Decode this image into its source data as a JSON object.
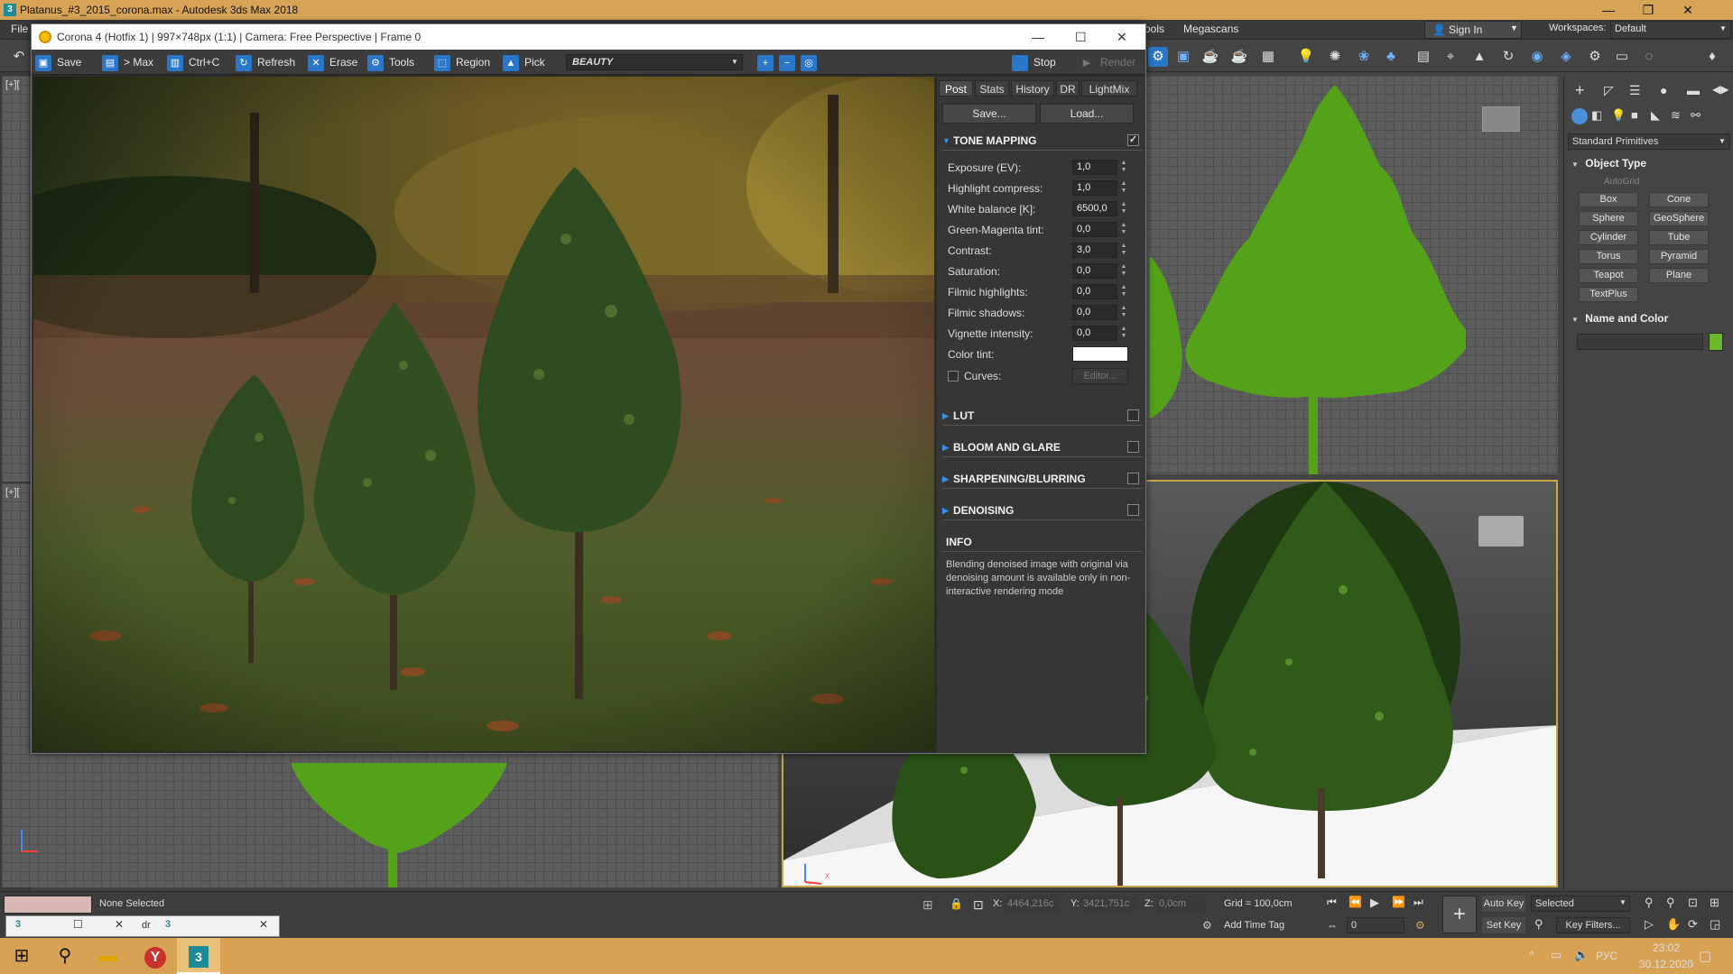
{
  "window": {
    "title": "Platanus_#3_2015_corona.max - Autodesk 3ds Max 2018",
    "app_icon": "3"
  },
  "menubar": {
    "file": "File",
    "tools_partial": "ools",
    "megascans": "Megascans",
    "sign_in": "Sign In",
    "workspaces_label": "Workspaces:",
    "workspaces_value": "Default"
  },
  "vfb": {
    "title": "Corona 4 (Hotfix 1) | 997×748px (1:1) | Camera: Free Perspective | Frame 0",
    "toolbar": {
      "save": "Save",
      "to_max": "> Max",
      "copy": "Ctrl+C",
      "refresh": "Refresh",
      "erase": "Erase",
      "tools": "Tools",
      "region": "Region",
      "pick": "Pick",
      "channel": "BEAUTY",
      "stop": "Stop",
      "render": "Render"
    },
    "tabs": [
      "Post",
      "Stats",
      "History",
      "DR",
      "LightMix"
    ],
    "save_btn": "Save...",
    "load_btn": "Load...",
    "tone_mapping": {
      "header": "TONE MAPPING",
      "enabled": "✓",
      "rows": [
        {
          "label": "Exposure (EV):",
          "value": "1,0"
        },
        {
          "label": "Highlight compress:",
          "value": "1,0"
        },
        {
          "label": "White balance [K]:",
          "value": "6500,0"
        },
        {
          "label": "Green-Magenta tint:",
          "value": "0,0"
        },
        {
          "label": "Contrast:",
          "value": "3,0"
        },
        {
          "label": "Saturation:",
          "value": "0,0"
        },
        {
          "label": "Filmic highlights:",
          "value": "0,0"
        },
        {
          "label": "Filmic shadows:",
          "value": "0,0"
        },
        {
          "label": "Vignette intensity:",
          "value": "0,0"
        }
      ],
      "color_tint": "Color tint:",
      "color_tint_value": "#ffffff",
      "curves": "Curves:",
      "editor": "Editor..."
    },
    "sections": [
      "LUT",
      "BLOOM AND GLARE",
      "SHARPENING/BLURRING",
      "DENOISING"
    ],
    "info_header": "INFO",
    "info_text": "Blending denoised image with original via denoising amount is available only in non-interactive rendering mode"
  },
  "viewports": {
    "top_left_label": "[+][",
    "left_mid_label": "[+][",
    "persp_axis": "x"
  },
  "command_panel": {
    "dropdown": "Standard Primitives",
    "object_type": "Object Type",
    "autogrid": "AutoGrid",
    "buttons": [
      "Box",
      "Cone",
      "Sphere",
      "GeoSphere",
      "Cylinder",
      "Tube",
      "Torus",
      "Pyramid",
      "Teapot",
      "Plane",
      "TextPlus"
    ],
    "name_and_color": "Name and Color",
    "swatch": "#6ab82c"
  },
  "status": {
    "selection": "None Selected",
    "x_label": "X:",
    "x_value": "4464,216c",
    "y_label": "Y:",
    "y_value": "3421,751c",
    "z_label": "Z:",
    "z_value": "0,0cm",
    "grid": "Grid = 100,0cm",
    "add_time_tag": "Add Time Tag",
    "auto_key": "Auto Key",
    "selected": "Selected",
    "set_key": "Set Key",
    "key_filters": "Key Filters...",
    "frame": "0",
    "dr_fragment": "dr"
  },
  "taskbar": {
    "lang": "РУС",
    "time": "23:02",
    "date": "30.12.2020"
  },
  "colors": {
    "accent": "#d7a356",
    "corona_blue": "#2a77c9",
    "tree_green": "#53a21a"
  }
}
